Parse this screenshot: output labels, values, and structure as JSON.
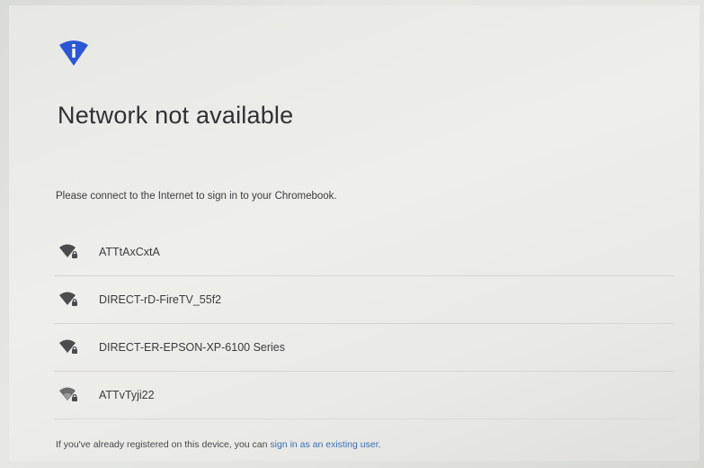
{
  "header": {
    "icon": "info-shield-icon",
    "title": "Network not available",
    "subtitle": "Please connect to the Internet to sign in to your Chromebook."
  },
  "networks": [
    {
      "name": "ATTtAxCxtA",
      "icon": "wifi-locked-icon"
    },
    {
      "name": "DIRECT-rD-FireTV_55f2",
      "icon": "wifi-locked-icon"
    },
    {
      "name": "DIRECT-ER-EPSON-XP-6100 Series",
      "icon": "wifi-locked-icon"
    },
    {
      "name": "ATTvTyji22",
      "icon": "wifi-locked-icon"
    }
  ],
  "footer": {
    "text": "If you've already registered on this device, you can ",
    "link": "sign in as an existing user",
    "end": "."
  },
  "colors": {
    "accent": "#2b57d4",
    "link": "#3a6fb5",
    "text": "#2f3133"
  }
}
